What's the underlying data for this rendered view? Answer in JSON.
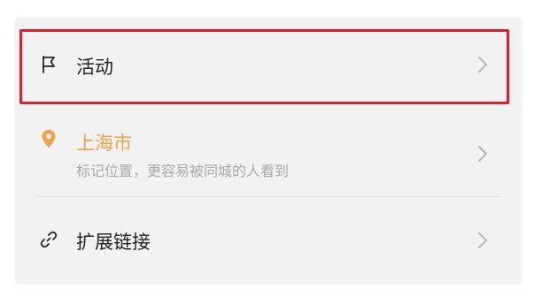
{
  "menu": {
    "activity": {
      "icon": "flag-icon",
      "label": "活动",
      "chevron": "chevron-right-icon"
    },
    "location": {
      "icon": "location-pin-icon",
      "title": "上海市",
      "subtitle": "标记位置，更容易被同城的人看到",
      "chevron": "chevron-right-icon"
    },
    "link": {
      "icon": "link-icon",
      "label": "扩展链接",
      "chevron": "chevron-right-icon"
    }
  },
  "colors": {
    "card_background": "#f2f2f2",
    "highlight_border": "#e01c2c",
    "location_accent": "#f0a047",
    "primary_text": "#222222",
    "secondary_text": "#a8a8a8",
    "chevron": "#b5b5b5"
  }
}
